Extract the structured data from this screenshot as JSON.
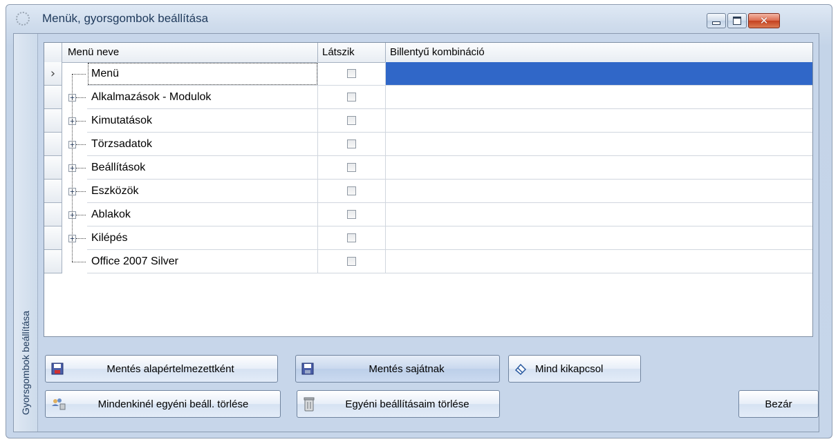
{
  "window": {
    "title": "Menük, gyorsgombok beállítása",
    "side_tab": "Gyorsgombok beállítása"
  },
  "grid": {
    "columns": [
      "Menü neve",
      "Látszik",
      "Billentyű kombináció"
    ],
    "rows": [
      {
        "name": "Menü",
        "visible": false,
        "keys": "",
        "selected": true,
        "expandable": false
      },
      {
        "name": "Alkalmazások - Modulok",
        "visible": false,
        "keys": "",
        "selected": false,
        "expandable": true
      },
      {
        "name": "Kimutatások",
        "visible": false,
        "keys": "",
        "selected": false,
        "expandable": true
      },
      {
        "name": "Törzsadatok",
        "visible": false,
        "keys": "",
        "selected": false,
        "expandable": true
      },
      {
        "name": "Beállítások",
        "visible": false,
        "keys": "",
        "selected": false,
        "expandable": true
      },
      {
        "name": "Eszközök",
        "visible": false,
        "keys": "",
        "selected": false,
        "expandable": true
      },
      {
        "name": "Ablakok",
        "visible": false,
        "keys": "",
        "selected": false,
        "expandable": true
      },
      {
        "name": "Kilépés",
        "visible": false,
        "keys": "",
        "selected": false,
        "expandable": true
      },
      {
        "name": "Office 2007 Silver",
        "visible": false,
        "keys": "",
        "selected": false,
        "expandable": false
      }
    ],
    "current_row_marker": "›"
  },
  "buttons": {
    "save_default": "Mentés alapértelmezettként",
    "save_own": "Mentés sajátnak",
    "disable_all": "Mind kikapcsol",
    "delete_everyones": "Mindenkinél egyéni beáll.  törlése",
    "delete_mine": "Egyéni beállításaim törlése",
    "close": "Bezár"
  },
  "icons": {
    "window_close": "✕",
    "expander": "+"
  },
  "colors": {
    "selection": "#3067c8",
    "panel": "#c7d6ea"
  }
}
